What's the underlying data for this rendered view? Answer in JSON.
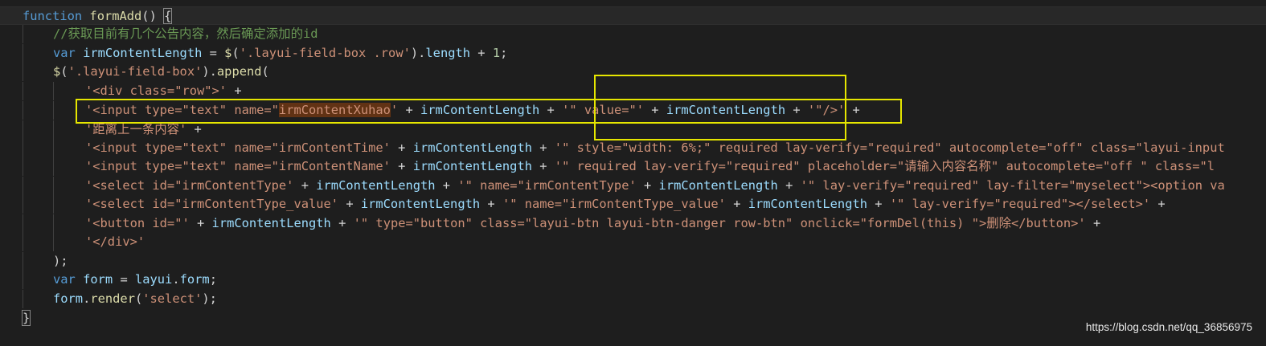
{
  "editor": {
    "lines": [
      [
        {
          "t": "function",
          "c": "kw"
        },
        {
          "t": " ",
          "c": "pn"
        },
        {
          "t": "formAdd",
          "c": "fn"
        },
        {
          "t": "() ",
          "c": "pn"
        },
        {
          "t": "{",
          "c": "pn",
          "box": true
        }
      ],
      [
        {
          "t": "//获取目前有几个公告内容，然后确定添加的id",
          "c": "cm"
        }
      ],
      [
        {
          "t": "var",
          "c": "kw"
        },
        {
          "t": " ",
          "c": "pn"
        },
        {
          "t": "irmContentLength",
          "c": "var"
        },
        {
          "t": " = ",
          "c": "pn"
        },
        {
          "t": "$",
          "c": "fn"
        },
        {
          "t": "(",
          "c": "pn"
        },
        {
          "t": "'.layui-field-box .row'",
          "c": "str"
        },
        {
          "t": ").",
          "c": "pn"
        },
        {
          "t": "length",
          "c": "var"
        },
        {
          "t": " + ",
          "c": "pn"
        },
        {
          "t": "1",
          "c": "num"
        },
        {
          "t": ";",
          "c": "pn"
        }
      ],
      [
        {
          "t": "$",
          "c": "fn"
        },
        {
          "t": "(",
          "c": "pn"
        },
        {
          "t": "'.layui-field-box'",
          "c": "str"
        },
        {
          "t": ").",
          "c": "pn"
        },
        {
          "t": "append",
          "c": "fn"
        },
        {
          "t": "(",
          "c": "pn"
        }
      ],
      [
        {
          "t": "'<div class=\"row\">'",
          "c": "str"
        },
        {
          "t": " +",
          "c": "pn"
        }
      ],
      [
        {
          "t": "'<input type=\"text\" name=\"",
          "c": "str"
        },
        {
          "t": "irmContentXuhao",
          "c": "str",
          "hl": true
        },
        {
          "t": "'",
          "c": "str"
        },
        {
          "t": " + ",
          "c": "pn"
        },
        {
          "t": "irmContentLength",
          "c": "var"
        },
        {
          "t": " + ",
          "c": "pn"
        },
        {
          "t": "'\" value=\"'",
          "c": "str"
        },
        {
          "t": " + ",
          "c": "pn"
        },
        {
          "t": "irmContentLength",
          "c": "var"
        },
        {
          "t": " + ",
          "c": "pn"
        },
        {
          "t": "'\"/>'",
          "c": "str"
        },
        {
          "t": " +",
          "c": "pn"
        }
      ],
      [
        {
          "t": "'距离上一条内容'",
          "c": "str"
        },
        {
          "t": " +",
          "c": "pn"
        }
      ],
      [
        {
          "t": "'<input type=\"text\" name=\"irmContentTime'",
          "c": "str"
        },
        {
          "t": " + ",
          "c": "pn"
        },
        {
          "t": "irmContentLength",
          "c": "var"
        },
        {
          "t": " + ",
          "c": "pn"
        },
        {
          "t": "'\" style=\"width: 6%;\" required lay-verify=\"required\" autocomplete=\"off\" class=\"layui-input",
          "c": "str"
        }
      ],
      [
        {
          "t": "'<input type=\"text\" name=\"irmContentName'",
          "c": "str"
        },
        {
          "t": " + ",
          "c": "pn"
        },
        {
          "t": "irmContentLength",
          "c": "var"
        },
        {
          "t": " + ",
          "c": "pn"
        },
        {
          "t": "'\" required lay-verify=\"required\" placeholder=\"请输入内容名称\" autocomplete=\"off \" class=\"l",
          "c": "str"
        }
      ],
      [
        {
          "t": "'<select id=\"irmContentType'",
          "c": "str"
        },
        {
          "t": " + ",
          "c": "pn"
        },
        {
          "t": "irmContentLength",
          "c": "var"
        },
        {
          "t": " + ",
          "c": "pn"
        },
        {
          "t": "'\" name=\"irmContentType'",
          "c": "str"
        },
        {
          "t": " + ",
          "c": "pn"
        },
        {
          "t": "irmContentLength",
          "c": "var"
        },
        {
          "t": " + ",
          "c": "pn"
        },
        {
          "t": "'\" lay-verify=\"required\" lay-filter=\"myselect\"><option va",
          "c": "str"
        }
      ],
      [
        {
          "t": "'<select id=\"irmContentType_value'",
          "c": "str"
        },
        {
          "t": " + ",
          "c": "pn"
        },
        {
          "t": "irmContentLength",
          "c": "var"
        },
        {
          "t": " + ",
          "c": "pn"
        },
        {
          "t": "'\" name=\"irmContentType_value'",
          "c": "str"
        },
        {
          "t": " + ",
          "c": "pn"
        },
        {
          "t": "irmContentLength",
          "c": "var"
        },
        {
          "t": " + ",
          "c": "pn"
        },
        {
          "t": "'\" lay-verify=\"required\"></select>'",
          "c": "str"
        },
        {
          "t": " +",
          "c": "pn"
        }
      ],
      [
        {
          "t": "'<button id=\"'",
          "c": "str"
        },
        {
          "t": " + ",
          "c": "pn"
        },
        {
          "t": "irmContentLength",
          "c": "var"
        },
        {
          "t": " + ",
          "c": "pn"
        },
        {
          "t": "'\" type=\"button\" class=\"layui-btn layui-btn-danger row-btn\" onclick=\"formDel(this) \">删除</button>'",
          "c": "str"
        },
        {
          "t": " +",
          "c": "pn"
        }
      ],
      [
        {
          "t": "'</div>'",
          "c": "str"
        }
      ],
      [
        {
          "t": ");",
          "c": "pn"
        }
      ],
      [
        {
          "t": "var",
          "c": "kw"
        },
        {
          "t": " ",
          "c": "pn"
        },
        {
          "t": "form",
          "c": "var"
        },
        {
          "t": " = ",
          "c": "pn"
        },
        {
          "t": "layui",
          "c": "var"
        },
        {
          "t": ".",
          "c": "pn"
        },
        {
          "t": "form",
          "c": "var"
        },
        {
          "t": ";",
          "c": "pn"
        }
      ],
      [
        {
          "t": "form",
          "c": "var"
        },
        {
          "t": ".",
          "c": "pn"
        },
        {
          "t": "render",
          "c": "fn"
        },
        {
          "t": "(",
          "c": "pn"
        },
        {
          "t": "'select'",
          "c": "str"
        },
        {
          "t": ");",
          "c": "pn"
        }
      ],
      [
        {
          "t": "}",
          "c": "pn",
          "box": true
        }
      ]
    ],
    "colors": {
      "keyword": "#569cd6",
      "function": "#dcdcaa",
      "variable": "#9cdcfe",
      "string": "#ce9178",
      "number": "#b5cea8",
      "comment": "#6a9955",
      "highlight_box": "#e6e600",
      "background": "#1e1e1e"
    }
  },
  "watermark": "https://blog.csdn.net/qq_36856975"
}
